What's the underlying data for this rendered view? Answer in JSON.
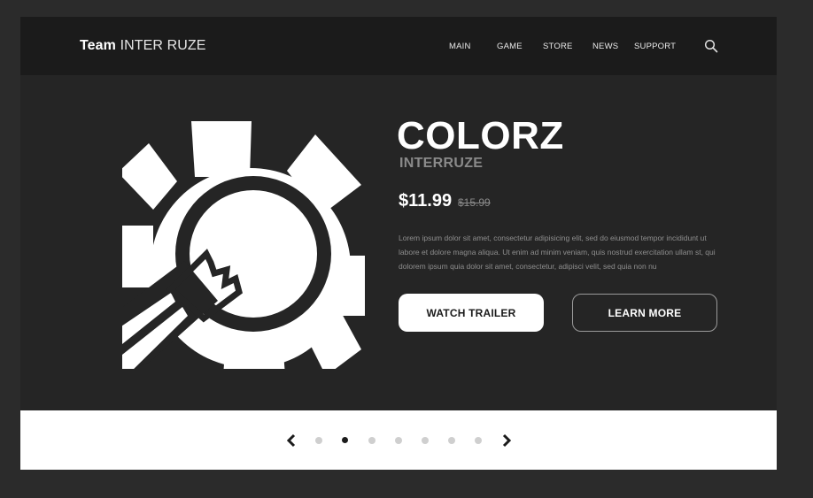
{
  "header": {
    "brand_bold": "Team",
    "brand_light": "INTER RUZE",
    "nav": [
      "MAIN",
      "GAME",
      "STORE",
      "NEWS",
      "SUPPORT"
    ]
  },
  "product": {
    "title": "COLORZ",
    "subtitle": "INTERRUZE",
    "price": "$11.99",
    "old_price": "$15.99",
    "description": "Lorem ipsum dolor sit amet, consectetur adipisicing elit, sed do eiusmod tempor incididunt ut labore et dolore magna aliqua. Ut enim ad minim veniam, quis nostrud exercitation ullam st, qui dolorem ipsum quia dolor sit amet, consectetur, adipisci velit, sed quia non nu",
    "primary_button": "WATCH TRAILER",
    "secondary_button": "LEARN MORE"
  },
  "carousel": {
    "slide_count": 7,
    "active_index": 1
  },
  "icons": {
    "search": "search-icon",
    "hero": "gear-lightbulb-icon",
    "prev": "chevron-left-icon",
    "next": "chevron-right-icon"
  },
  "colors": {
    "background": "#2b2b2b",
    "panel": "#252525",
    "header": "#1b1b1b",
    "accent": "#ffffff",
    "muted": "#8a8a8a"
  }
}
